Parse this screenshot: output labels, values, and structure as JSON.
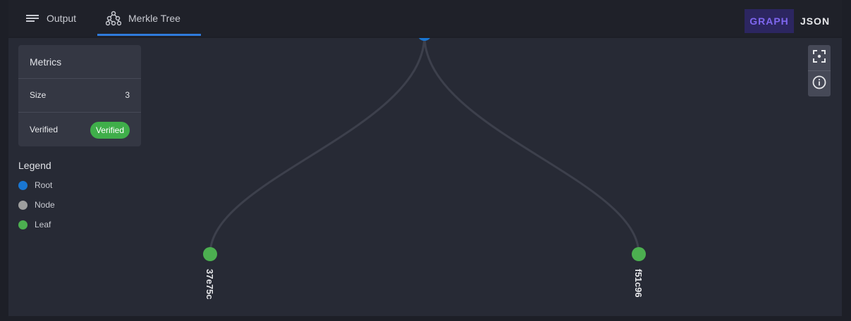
{
  "tabs": {
    "output": {
      "label": "Output",
      "icon": "lines-icon"
    },
    "merkle": {
      "label": "Merkle Tree",
      "icon": "tree-icon"
    }
  },
  "view_toggle": {
    "graph": "GRAPH",
    "json": "JSON"
  },
  "metrics": {
    "title": "Metrics",
    "rows": [
      {
        "label": "Size",
        "value": "3"
      },
      {
        "label": "Verified",
        "badge": "Verified"
      }
    ]
  },
  "legend": {
    "title": "Legend",
    "items": [
      {
        "label": "Root",
        "color": "#1976d2"
      },
      {
        "label": "Node",
        "color": "#9e9e9e"
      },
      {
        "label": "Leaf",
        "color": "#4caf50"
      }
    ]
  },
  "tree": {
    "leaves": [
      {
        "label": "37e75c"
      },
      {
        "label": "f51c96"
      }
    ],
    "colors": {
      "edge": "#3d404c",
      "root": "#1976d2",
      "leaf": "#4caf50"
    }
  },
  "tools": {
    "fit": "fit-view-icon",
    "info": "info-icon"
  }
}
